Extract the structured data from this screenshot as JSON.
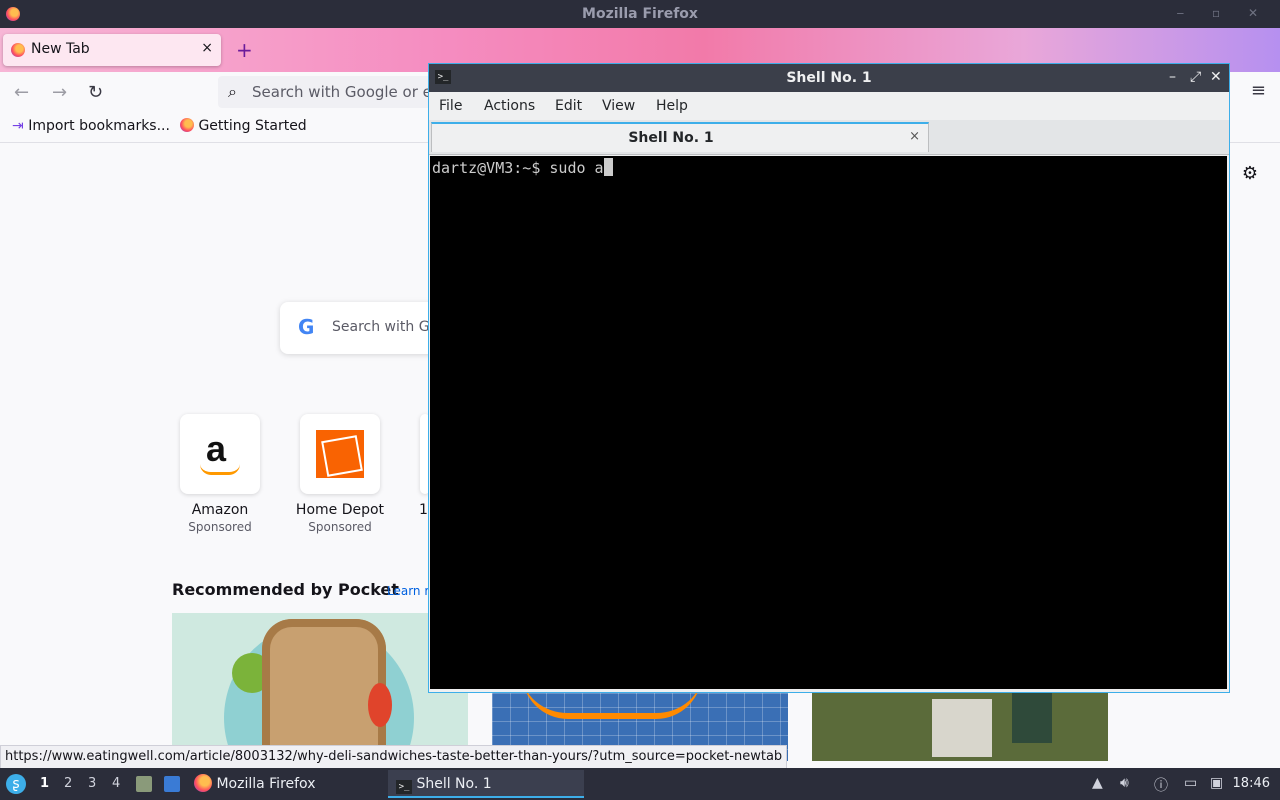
{
  "firefox": {
    "window_title": "Mozilla Firefox",
    "tab_label": "New Tab",
    "tab_close": "×",
    "new_tab_symbol": "+",
    "urlbar_placeholder": "Search with Google or en",
    "bookmarks": [
      "Import bookmarks...",
      "Getting Started"
    ],
    "newtab": {
      "search_placeholder": "Search with G",
      "google_letter": "G",
      "tiles": [
        {
          "name": "Amazon",
          "sub": "Sponsored"
        },
        {
          "name": "Home Depot",
          "sub": "Sponsored"
        }
      ],
      "tile_partial_label": "1",
      "pocket_heading": "Recommended by Pocket",
      "pocket_learn": "Learn r"
    },
    "status_url": "https://www.eatingwell.com/article/8003132/why-deli-sandwiches-taste-better-than-yours/?utm_source=pocket-newtab"
  },
  "terminal": {
    "title": "Shell No. 1",
    "menu": [
      "File",
      "Actions",
      "Edit",
      "View",
      "Help"
    ],
    "tab_label": "Shell No. 1",
    "tab_close": "×",
    "prompt": "dartz@VM3:~$ sudo a"
  },
  "taskbar": {
    "workspaces": [
      "1",
      "2",
      "3",
      "4"
    ],
    "tasks": [
      "Mozilla Firefox",
      "Shell No. 1"
    ],
    "clock": "18:46"
  },
  "colors": {
    "accent": "#3daee9",
    "taskbar_bg": "#2b2d3a",
    "terminal_bg": "#000000"
  }
}
